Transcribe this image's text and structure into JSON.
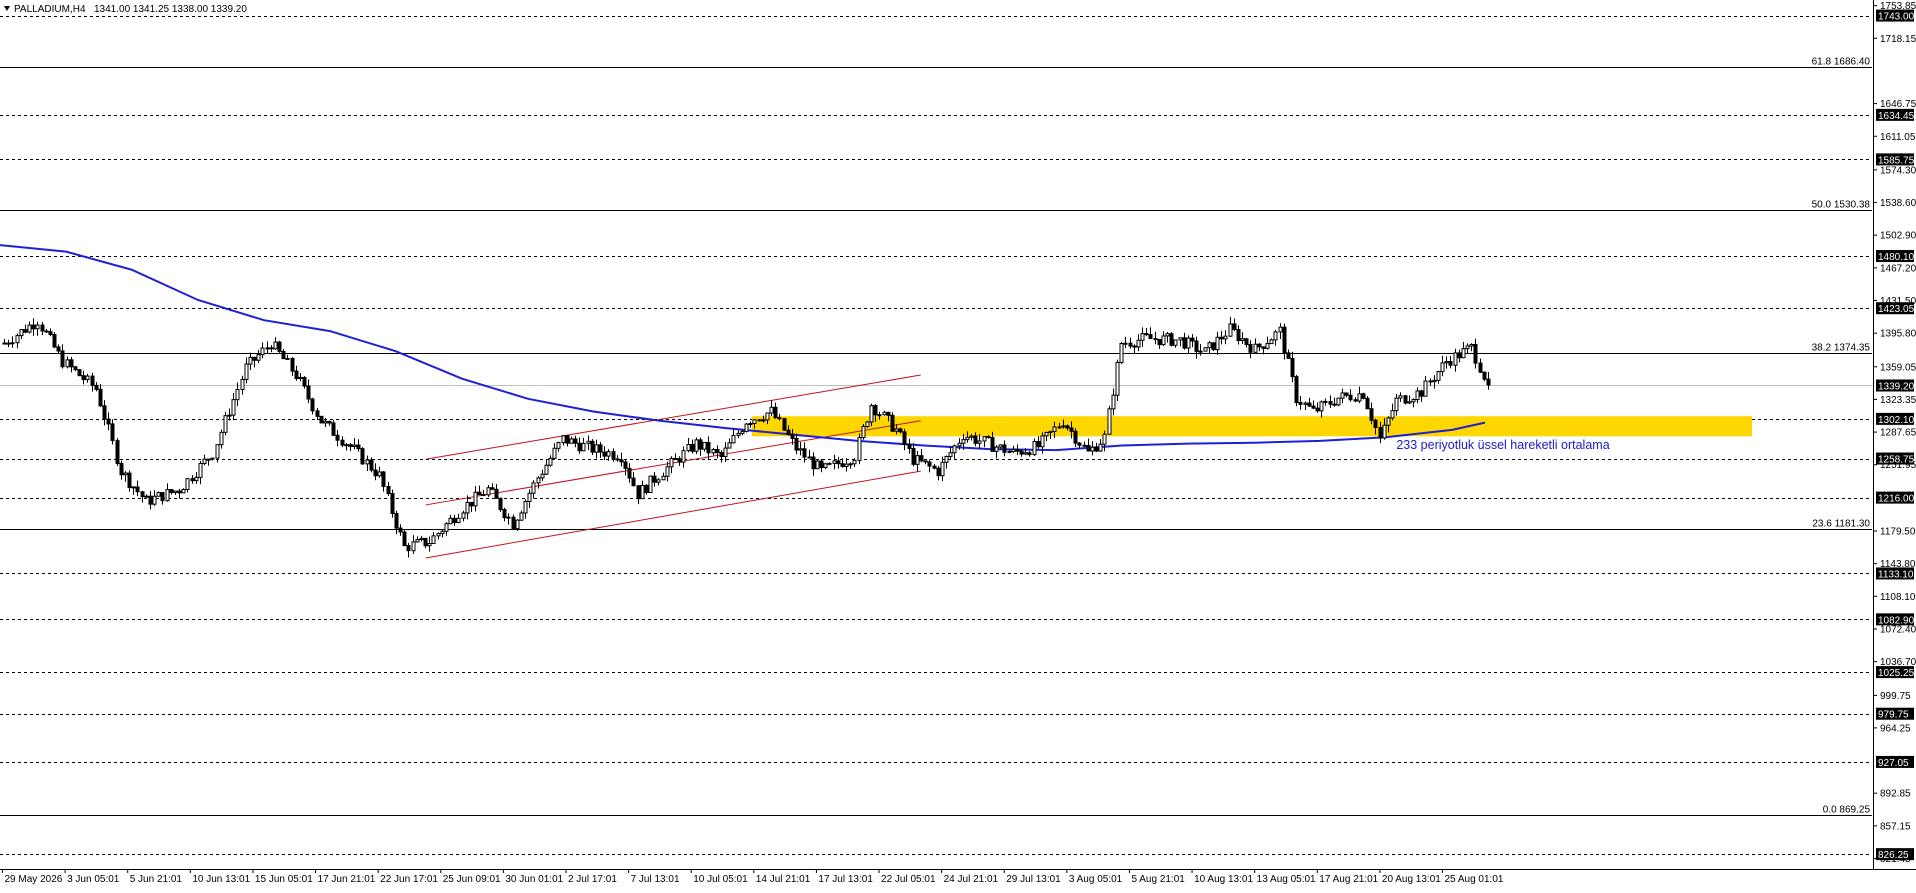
{
  "header": {
    "menu_icon": "triangle-down-icon",
    "symbol": "PALLADIUM,H4",
    "ohlc": "1341.00 1341.25 1338.00 1339.20"
  },
  "colors": {
    "background": "#ffffff",
    "candle": "#000000",
    "ema": "#1f1fd6",
    "zone": "#ffd700",
    "channel": "#c0141c",
    "tag_background": "#000000",
    "tag_text": "#ffffff",
    "annotation": "#1a1acc"
  },
  "annotation": "233 periyotluk üssel hareketli ortalama",
  "chart_data": {
    "type": "candlestick",
    "title": "PALLADIUM,H4",
    "ylim": [
      810,
      1760
    ],
    "y_ticks": [
      "1753.85",
      "1718.15",
      "1646.75",
      "1611.05",
      "1574.30",
      "1538.60",
      "1502.90",
      "1467.20",
      "1431.50",
      "1395.80",
      "1359.05",
      "1323.35",
      "1287.65",
      "1251.95",
      "1179.50",
      "1143.80",
      "1108.10",
      "1072.40",
      "1036.70",
      "999.75",
      "964.25",
      "892.85",
      "857.15",
      "821.45"
    ],
    "current_price": "1339.20",
    "x_labels": [
      "29 May 2026",
      "3 Jun 05:01",
      "5 Jun 21:01",
      "10 Jun 13:01",
      "15 Jun 05:01",
      "17 Jun 21:01",
      "22 Jun 17:01",
      "25 Jun 09:01",
      "30 Jun 01:01",
      "2 Jul 17:01",
      "7 Jul 13:01",
      "10 Jul 05:01",
      "14 Jul 21:01",
      "17 Jul 13:01",
      "22 Jul 05:01",
      "24 Jul 21:01",
      "29 Jul 13:01",
      "3 Aug 05:01",
      "5 Aug 21:01",
      "10 Aug 13:01",
      "13 Aug 05:01",
      "17 Aug 21:01",
      "20 Aug 13:01",
      "25 Aug 01:01"
    ],
    "horizontal_levels": [
      {
        "label": "1743.00",
        "value": 1743.0
      },
      {
        "label": "1634.45",
        "value": 1634.45
      },
      {
        "label": "1585.75",
        "value": 1585.75
      },
      {
        "label": "1480.10",
        "value": 1480.1
      },
      {
        "label": "1423.05",
        "value": 1423.05
      },
      {
        "label": "1302.10",
        "value": 1302.1
      },
      {
        "label": "1258.75",
        "value": 1258.75
      },
      {
        "label": "1216.00",
        "value": 1216.0
      },
      {
        "label": "1133.10",
        "value": 1133.1
      },
      {
        "label": "1082.90",
        "value": 1082.9
      },
      {
        "label": "1025.25",
        "value": 1025.25
      },
      {
        "label": "979.75",
        "value": 979.75
      },
      {
        "label": "927.05",
        "value": 927.05
      },
      {
        "label": "826.25",
        "value": 826.25
      }
    ],
    "fibonacci": [
      {
        "label": "61.8 1686.40",
        "value": 1686.4
      },
      {
        "label": "50.0 1530.38",
        "value": 1530.38
      },
      {
        "label": "38.2 1374.35",
        "value": 1374.35
      },
      {
        "label": "23.6 1181.30",
        "value": 1181.3
      },
      {
        "label": "0.0 869.25",
        "value": 869.25
      }
    ],
    "zone": {
      "low": 1283,
      "high": 1305
    },
    "price_path": [
      {
        "i": 0,
        "p": 1385
      },
      {
        "i": 8,
        "p": 1410
      },
      {
        "i": 14,
        "p": 1365
      },
      {
        "i": 22,
        "p": 1335
      },
      {
        "i": 28,
        "p": 1245
      },
      {
        "i": 34,
        "p": 1212
      },
      {
        "i": 42,
        "p": 1225
      },
      {
        "i": 50,
        "p": 1265
      },
      {
        "i": 58,
        "p": 1358
      },
      {
        "i": 64,
        "p": 1385
      },
      {
        "i": 70,
        "p": 1350
      },
      {
        "i": 76,
        "p": 1300
      },
      {
        "i": 84,
        "p": 1268
      },
      {
        "i": 90,
        "p": 1240
      },
      {
        "i": 96,
        "p": 1162
      },
      {
        "i": 102,
        "p": 1168
      },
      {
        "i": 110,
        "p": 1205
      },
      {
        "i": 116,
        "p": 1225
      },
      {
        "i": 122,
        "p": 1188
      },
      {
        "i": 128,
        "p": 1238
      },
      {
        "i": 134,
        "p": 1280
      },
      {
        "i": 142,
        "p": 1268
      },
      {
        "i": 148,
        "p": 1262
      },
      {
        "i": 152,
        "p": 1220
      },
      {
        "i": 158,
        "p": 1245
      },
      {
        "i": 166,
        "p": 1275
      },
      {
        "i": 172,
        "p": 1260
      },
      {
        "i": 178,
        "p": 1300
      },
      {
        "i": 184,
        "p": 1310
      },
      {
        "i": 190,
        "p": 1270
      },
      {
        "i": 196,
        "p": 1245
      },
      {
        "i": 204,
        "p": 1262
      },
      {
        "i": 208,
        "p": 1318
      },
      {
        "i": 214,
        "p": 1290
      },
      {
        "i": 218,
        "p": 1258
      },
      {
        "i": 224,
        "p": 1245
      },
      {
        "i": 230,
        "p": 1285
      },
      {
        "i": 236,
        "p": 1275
      },
      {
        "i": 242,
        "p": 1265
      },
      {
        "i": 248,
        "p": 1272
      },
      {
        "i": 254,
        "p": 1300
      },
      {
        "i": 260,
        "p": 1265
      },
      {
        "i": 264,
        "p": 1282
      },
      {
        "i": 268,
        "p": 1385
      },
      {
        "i": 274,
        "p": 1390
      },
      {
        "i": 282,
        "p": 1388
      },
      {
        "i": 288,
        "p": 1375
      },
      {
        "i": 294,
        "p": 1400
      },
      {
        "i": 300,
        "p": 1378
      },
      {
        "i": 306,
        "p": 1398
      },
      {
        "i": 310,
        "p": 1325
      },
      {
        "i": 314,
        "p": 1310
      },
      {
        "i": 320,
        "p": 1325
      },
      {
        "i": 326,
        "p": 1330
      },
      {
        "i": 330,
        "p": 1280
      },
      {
        "i": 334,
        "p": 1322
      },
      {
        "i": 340,
        "p": 1332
      },
      {
        "i": 346,
        "p": 1365
      },
      {
        "i": 352,
        "p": 1380
      },
      {
        "i": 356,
        "p": 1339.2
      }
    ],
    "ema_233": [
      {
        "x": 0.0,
        "p": 1492
      },
      {
        "x": 0.04,
        "p": 1485
      },
      {
        "x": 0.08,
        "p": 1465
      },
      {
        "x": 0.12,
        "p": 1432
      },
      {
        "x": 0.16,
        "p": 1410
      },
      {
        "x": 0.2,
        "p": 1398
      },
      {
        "x": 0.24,
        "p": 1376
      },
      {
        "x": 0.28,
        "p": 1346
      },
      {
        "x": 0.32,
        "p": 1324
      },
      {
        "x": 0.36,
        "p": 1310
      },
      {
        "x": 0.4,
        "p": 1300
      },
      {
        "x": 0.44,
        "p": 1292
      },
      {
        "x": 0.48,
        "p": 1285
      },
      {
        "x": 0.52,
        "p": 1278
      },
      {
        "x": 0.56,
        "p": 1273
      },
      {
        "x": 0.6,
        "p": 1269
      },
      {
        "x": 0.64,
        "p": 1268
      },
      {
        "x": 0.68,
        "p": 1273
      },
      {
        "x": 0.72,
        "p": 1275
      },
      {
        "x": 0.76,
        "p": 1276
      },
      {
        "x": 0.8,
        "p": 1278
      },
      {
        "x": 0.84,
        "p": 1282
      },
      {
        "x": 0.88,
        "p": 1290
      },
      {
        "x": 0.9,
        "p": 1298
      }
    ],
    "channel": {
      "upper": [
        {
          "x": 0.258,
          "p": 1258
        },
        {
          "x": 0.558,
          "p": 1350
        }
      ],
      "middle": [
        {
          "x": 0.258,
          "p": 1208
        },
        {
          "x": 0.558,
          "p": 1300
        }
      ],
      "lower": [
        {
          "x": 0.258,
          "p": 1150
        },
        {
          "x": 0.558,
          "p": 1245
        }
      ]
    },
    "ema_label": "233 periyotluk üssel hareketli ortalama",
    "grid": false
  }
}
